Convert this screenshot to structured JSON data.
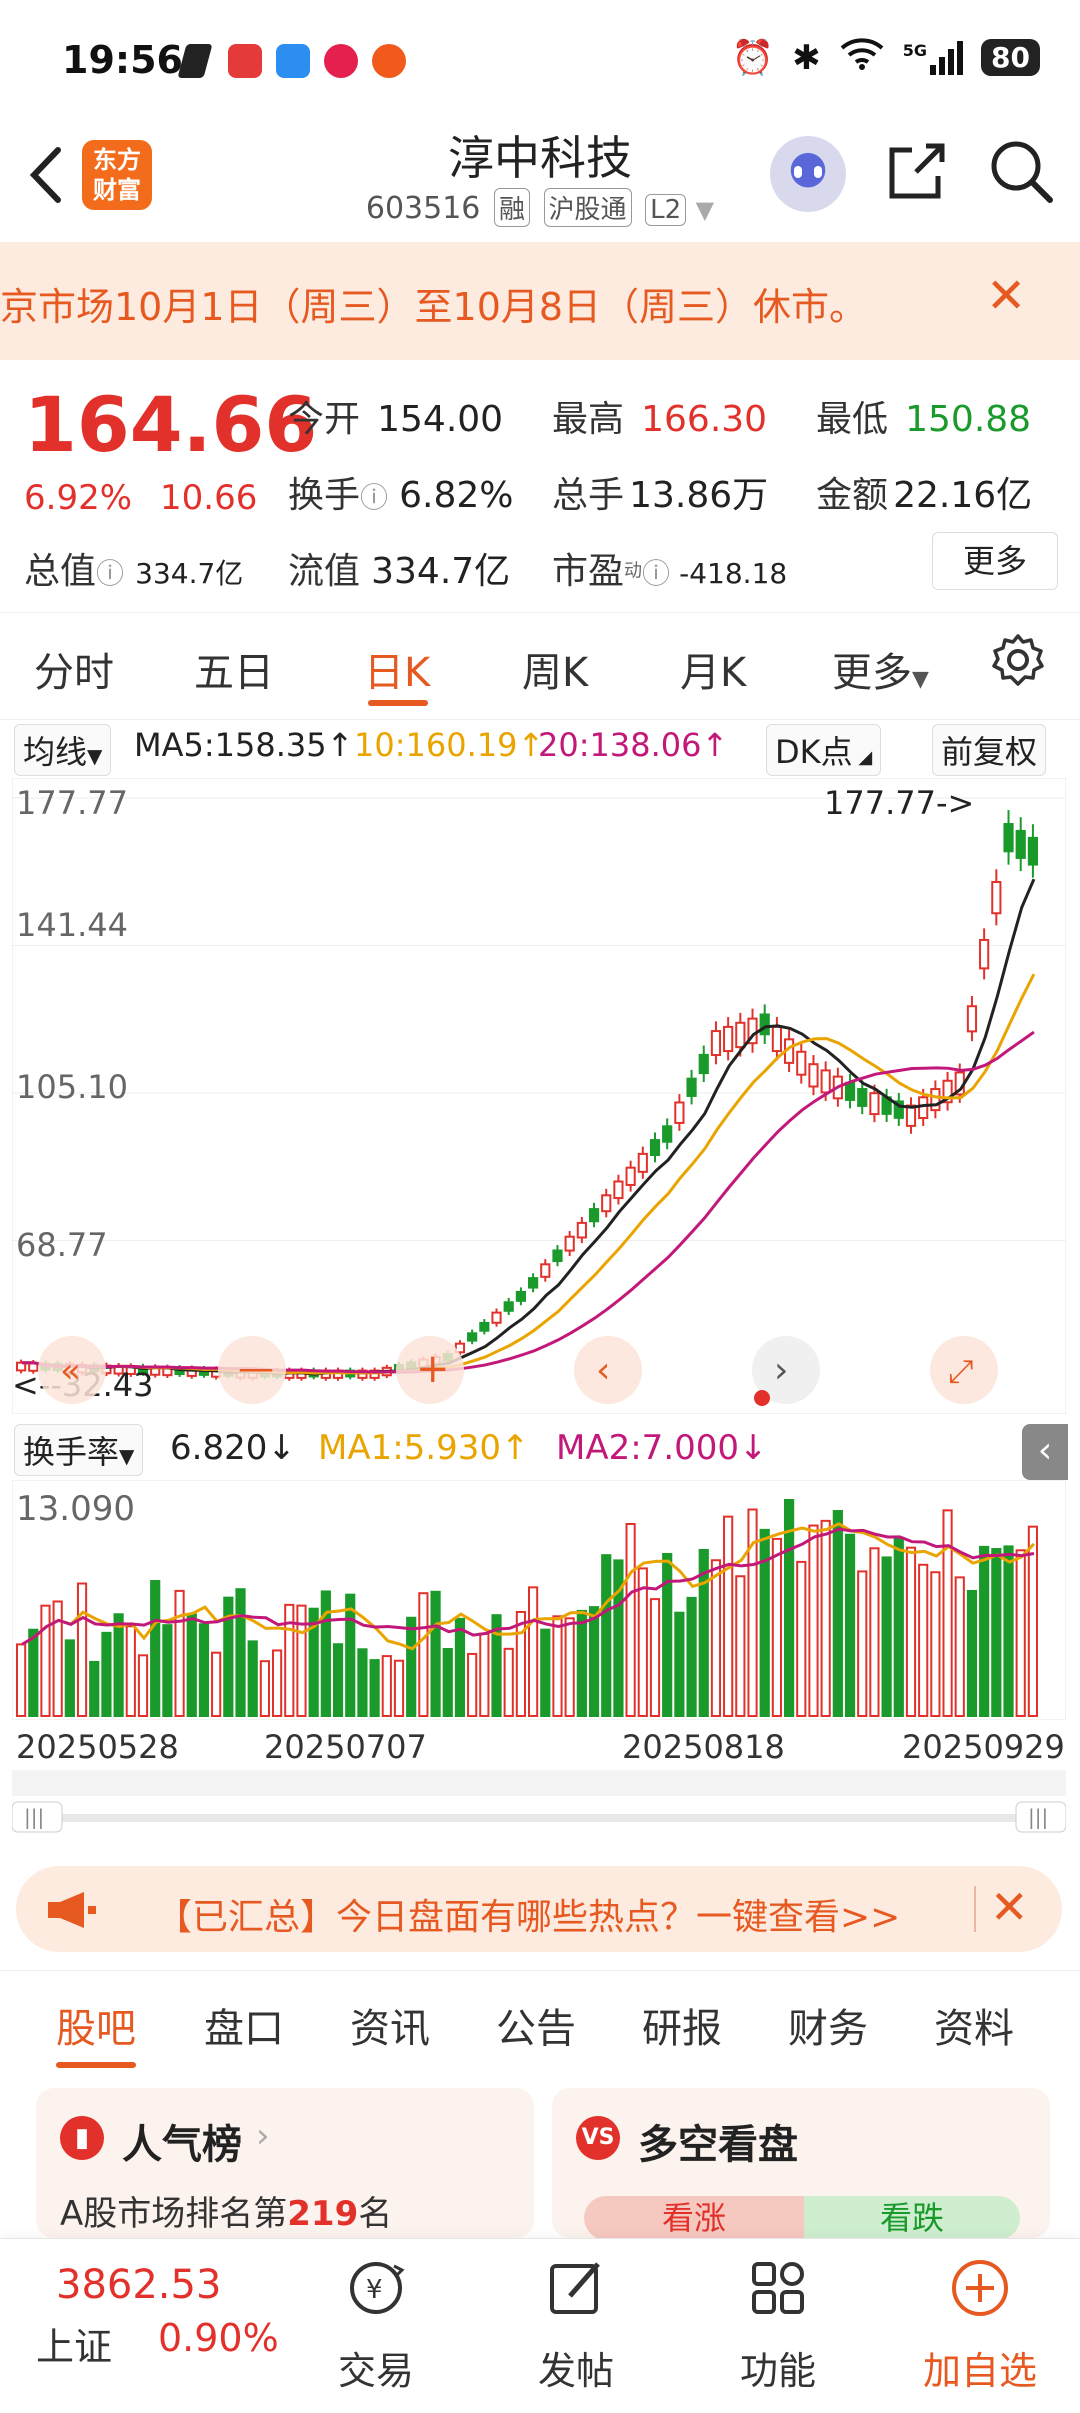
{
  "status_bar": {
    "time": "19:56",
    "network": "5G",
    "battery": "80"
  },
  "header": {
    "stock_name": "淳中科技",
    "code": "603516",
    "tags": [
      "融",
      "沪股通",
      "L2"
    ]
  },
  "notice": {
    "text": "京市场10月1日（周三）至10月8日（周三）休市。"
  },
  "quote": {
    "price": "164.66",
    "pct_change": "6.92%",
    "change": "10.66",
    "open_label": "今开",
    "open": "154.00",
    "high_label": "最高",
    "high": "166.30",
    "low_label": "最低",
    "low": "150.88",
    "turnover_label": "换手",
    "turnover": "6.82%",
    "volume_label": "总手",
    "volume": "13.86万",
    "amount_label": "金额",
    "amount": "22.16亿",
    "mktcap_label": "总值",
    "mktcap": "334.7亿",
    "float_label": "流值",
    "float": "334.7亿",
    "pe_label": "市盈",
    "pe_sup": "动",
    "pe": "-418.18",
    "more": "更多"
  },
  "period_tabs": [
    "分时",
    "五日",
    "日K",
    "周K",
    "月K",
    "更多"
  ],
  "ma_row": {
    "selector": "均线",
    "ma5": "MA5:158.35↑",
    "ma10": "10:160.19↑",
    "ma20": "20:138.06↑",
    "dk": "DK点",
    "adjust": "前复权",
    "colors": {
      "ma5": "#222222",
      "ma10": "#e9a400",
      "ma20": "#c2187a"
    }
  },
  "kchart_labels": {
    "y_ticks": [
      "177.77",
      "141.44",
      "105.10",
      "68.77"
    ],
    "max_marker": "177.77->",
    "min_marker": "<--32.43"
  },
  "turnover_row": {
    "selector": "换手率",
    "value": "6.820↓",
    "ma1": "MA1:5.930↑",
    "ma2": "MA2:7.000↓",
    "y_top": "13.090"
  },
  "dates": [
    "20250528",
    "20250707",
    "20250818",
    "20250929"
  ],
  "chart_data": {
    "type": "candlestick",
    "y_ticks": [
      177.77,
      141.44,
      105.1,
      68.77
    ],
    "ylim": [
      32.43,
      177.77
    ],
    "max": 177.77,
    "min": 32.43,
    "last_close": 164.66,
    "ma": {
      "MA5": 158.35,
      "MA10": 160.19,
      "MA20": 138.06
    },
    "x_ticks": [
      "20250528",
      "20250707",
      "20250818",
      "20250929"
    ]
  },
  "banner": {
    "text": "【已汇总】今日盘面有哪些热点？一键查看>>"
  },
  "bottom_tabs": [
    "股吧",
    "盘口",
    "资讯",
    "公告",
    "研报",
    "财务",
    "资料"
  ],
  "cards": {
    "popularity": {
      "title": "人气榜",
      "desc_prefix": "A股市场排名第",
      "rank": "219",
      "desc_suffix": "名"
    },
    "bullbear": {
      "title": "多空看盘",
      "up": "看涨",
      "down": "看跌"
    }
  },
  "bottom_nav": {
    "index_value": "3862.53",
    "index_name": "上证",
    "index_change": "0.90%",
    "items": [
      "交易",
      "发帖",
      "功能",
      "加自选"
    ]
  }
}
